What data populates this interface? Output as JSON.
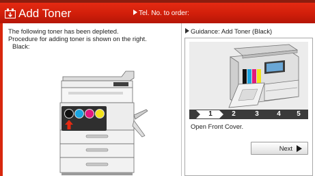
{
  "header": {
    "title": "Add Toner",
    "tel_label": "Tel. No. to order:"
  },
  "message": {
    "line1": "The following toner has been depleted.",
    "line2": "Procedure for adding toner is shown on the right.",
    "line3": "Black:"
  },
  "guidance": {
    "title": "Guidance: Add Toner (Black)",
    "steps": [
      "1",
      "2",
      "3",
      "4",
      "5"
    ],
    "current_step": "1",
    "instruction": "Open Front Cover.",
    "next_label": "Next"
  },
  "toner_colors": [
    "#111111",
    "#1aa3e0",
    "#e2197d",
    "#f2e21a"
  ],
  "accent": "#d8270d"
}
